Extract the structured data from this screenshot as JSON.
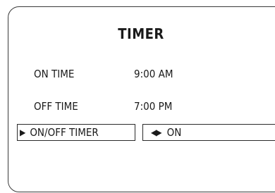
{
  "screen": {
    "title": "TIMER",
    "rows": [
      {
        "label": "ON TIME",
        "value": "9:00 AM"
      },
      {
        "label": "OFF TIME",
        "value": "7:00 PM"
      }
    ],
    "selected_item": {
      "icon": "pointer-right-icon",
      "label": "ON/OFF TIMER",
      "value_icon": "left-right-arrows-icon",
      "value": "ON"
    }
  }
}
